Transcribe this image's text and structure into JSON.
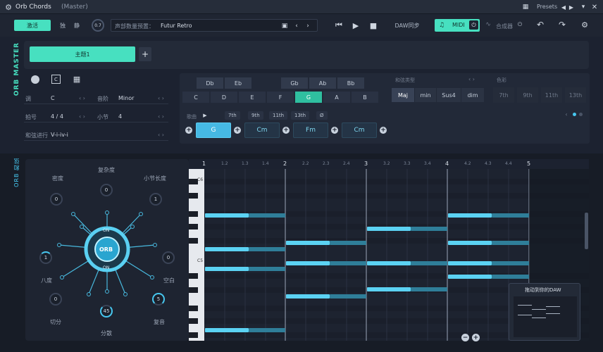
{
  "title": {
    "app": "Orb Chords",
    "subtitle": "(Master)",
    "presets_label": "Presets"
  },
  "toolbar": {
    "activate": "激活",
    "mute_solo": [
      "独",
      "静"
    ],
    "volume_knob": "0.7",
    "voicing_label": "声部数量预置：",
    "preset_name": "Futur Retro",
    "daw_sync": "DAW同步",
    "midi": "MIDI",
    "synth": "合成器"
  },
  "theme": {
    "label": "ORB MASTER",
    "tab": "主题1",
    "add": "+"
  },
  "params": [
    {
      "label": "调",
      "value": "C",
      "label2": "音阶",
      "value2": "Minor"
    },
    {
      "label": "拍号",
      "value": "4 / 4",
      "label2": "小节",
      "value2": "4"
    },
    {
      "label": "和弦进行",
      "value": "V-i-iv-i"
    }
  ],
  "chords": {
    "sharps": [
      "Db",
      "Eb",
      "Gb",
      "Ab",
      "Bb"
    ],
    "naturals": [
      "C",
      "D",
      "E",
      "F",
      "G",
      "A",
      "B"
    ],
    "selected_root": "G",
    "type_label": "和弦类型",
    "types": [
      "Maj",
      "min",
      "Sus4",
      "dim"
    ],
    "selected_type": "Maj",
    "color_label": "色彩",
    "extensions": [
      "7th",
      "9th",
      "11th",
      "13th"
    ],
    "voicing_label": "歌曲",
    "voicing_tags": [
      "7th",
      "9th",
      "11th",
      "13th",
      "Ø"
    ],
    "progression": [
      "G",
      "Cm",
      "Fm",
      "Cm"
    ]
  },
  "orb": {
    "side_label": "ORB 和弦",
    "center": "ORB",
    "on_top": "ON",
    "on_bottom": "ON",
    "knobs": [
      {
        "name": "复杂度",
        "value": "0"
      },
      {
        "name": "密度",
        "value": "0"
      },
      {
        "name": "小节长度",
        "value": "1"
      },
      {
        "name": "八度",
        "value": "1"
      },
      {
        "name": "空白",
        "value": "0"
      },
      {
        "name": "切分",
        "value": "0"
      },
      {
        "name": "复音",
        "value": "5"
      },
      {
        "name": "分散",
        "value": "45"
      }
    ]
  },
  "piano_roll": {
    "bars": [
      "1",
      "2",
      "3",
      "4",
      "5"
    ],
    "sub_beats": [
      [
        "1.2",
        "1.3",
        "1.4"
      ],
      [
        "2.2",
        "2.3",
        "2.4"
      ],
      [
        "3.2",
        "3.3",
        "3.4"
      ],
      [
        "4.2",
        "4.3",
        "4.4"
      ]
    ],
    "octave_labels": [
      "C6",
      "C5"
    ],
    "drag_label": "拖动到你的DAW"
  },
  "colors": {
    "accent": "#47e0c0",
    "note": "#5bd2f3",
    "bg": "#1c2230"
  }
}
